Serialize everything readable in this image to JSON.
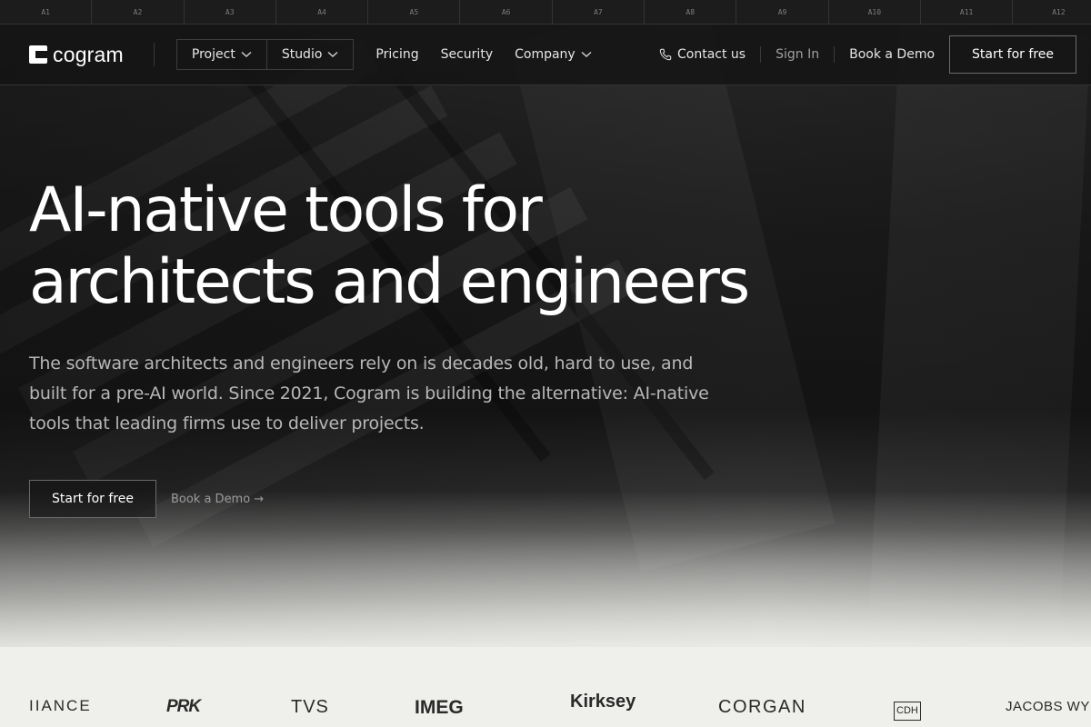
{
  "ruler": [
    "A1",
    "A2",
    "A3",
    "A4",
    "A5",
    "A6",
    "A7",
    "A8",
    "A9",
    "A10",
    "A11",
    "A12"
  ],
  "nav": {
    "logo_text": "cogram",
    "group": [
      {
        "label": "Project"
      },
      {
        "label": "Studio"
      }
    ],
    "links": [
      {
        "label": "Pricing"
      },
      {
        "label": "Security"
      },
      {
        "label": "Company"
      }
    ],
    "contact": "Contact us",
    "sign_in": "Sign In",
    "book_demo": "Book a Demo",
    "start": "Start for free"
  },
  "hero": {
    "title_line1": "AI-native tools for",
    "title_line2": "architects and engineers",
    "subtitle": "The software architects and engineers rely on is decades old, hard to use, and built for a pre-AI world. Since 2021, Cogram is building the alternative: AI-native tools that leading firms use to deliver projects.",
    "cta_primary": "Start for free",
    "cta_secondary": "Book a Demo →"
  },
  "logos": [
    "IIANCE",
    "PRK",
    "TVS",
    "IMEG",
    "Kirksey",
    "CORGAN",
    "CDH",
    "JACOBS WYPER ARCHITECTS"
  ],
  "colors": {
    "background": "#111111",
    "text": "#ffffff",
    "muted": "#a0a0a0",
    "logo_strip": "#efefeb"
  }
}
